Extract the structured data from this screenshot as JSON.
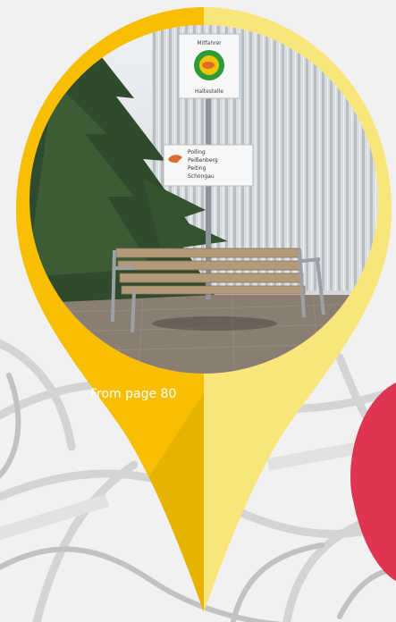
{
  "caption": {
    "text": "From page 80"
  },
  "pin": {
    "left_color": "#f7bf00",
    "right_color": "#f9e67a"
  },
  "accent": {
    "color": "#e03453"
  },
  "photo": {
    "main_sign": [
      "Mitfahrer",
      "Haltestelle"
    ],
    "direction_sign": [
      "Polling",
      "Peißenberg",
      "Peiting",
      "Schongau"
    ]
  }
}
